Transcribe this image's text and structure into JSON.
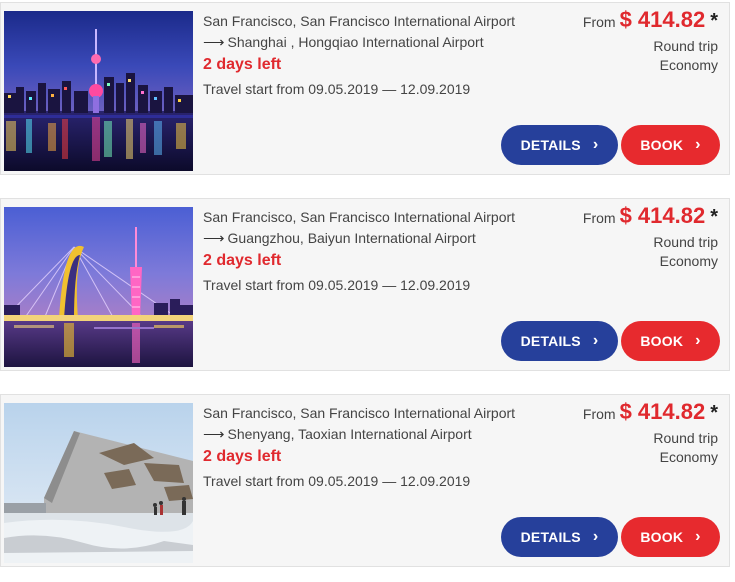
{
  "flights": [
    {
      "image": "shanghai-skyline-night",
      "from": "San Francisco, San Francisco International Airport",
      "to": "Shanghai , Hongqiao International Airport",
      "days_left": "2 days left",
      "travel_dates": "Travel start from 09.05.2019 — 12.09.2019",
      "from_label": "From",
      "price": "$ 414.82",
      "asterisk": "*",
      "trip_type": "Round trip",
      "cabin": "Economy",
      "details_label": "DETAILS",
      "book_label": "BOOK"
    },
    {
      "image": "guangzhou-bridge-tower-night",
      "from": "San Francisco, San Francisco International Airport",
      "to": "Guangzhou, Baiyun International Airport",
      "days_left": "2 days left",
      "travel_dates": "Travel start from 09.05.2019 — 12.09.2019",
      "from_label": "From",
      "price": "$ 414.82",
      "asterisk": "*",
      "trip_type": "Round trip",
      "cabin": "Economy",
      "details_label": "DETAILS",
      "book_label": "BOOK"
    },
    {
      "image": "shenyang-memorial-winter",
      "from": "San Francisco, San Francisco International Airport",
      "to": "Shenyang, Taoxian International Airport",
      "days_left": "2 days left",
      "travel_dates": "Travel start from 09.05.2019 — 12.09.2019",
      "from_label": "From",
      "price": "$ 414.82",
      "asterisk": "*",
      "trip_type": "Round trip",
      "cabin": "Economy",
      "details_label": "DETAILS",
      "book_label": "BOOK"
    }
  ],
  "icons": {
    "arrow": "arrow-right-icon",
    "chevron": "chevron-right-icon"
  },
  "colors": {
    "price_red": "#e0292e",
    "details_blue": "#26409b",
    "book_red": "#e72a2e",
    "card_bg": "#f6f6f6"
  }
}
